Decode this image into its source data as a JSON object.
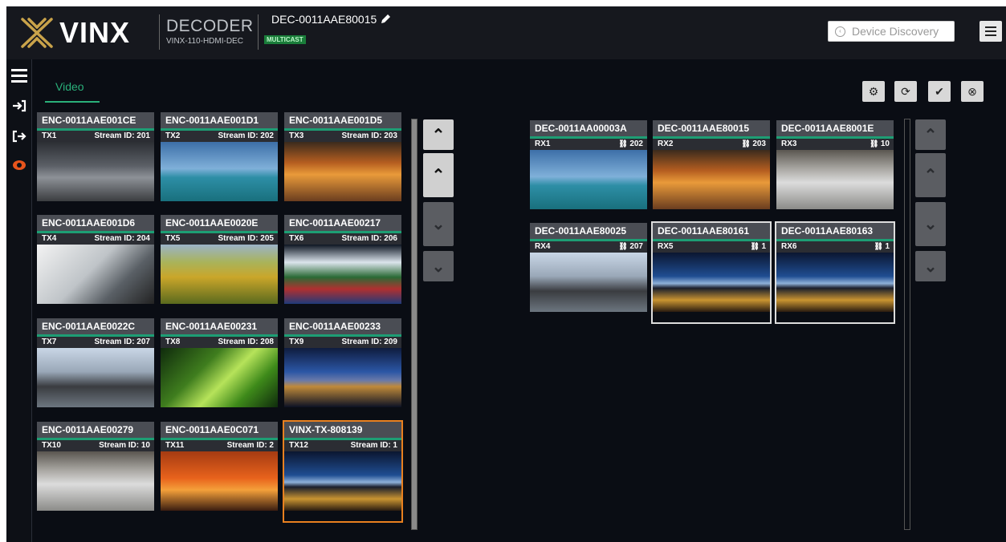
{
  "header": {
    "brand": "VINX",
    "device_type": "DECODER",
    "device_model": "VINX-110-HDMI-DEC",
    "device_name": "DEC-0011AAE80015",
    "mode_badge": "MULTICAST",
    "discovery_label": "Device Discovery"
  },
  "tabs": [
    {
      "label": "Video"
    }
  ],
  "toolbar": [
    "gear-icon",
    "refresh-icon",
    "check-icon",
    "close-icon"
  ],
  "colors": {
    "accent": "#1d9e74",
    "selected_tx": "#e8801f",
    "selected_rx": "#dddddd",
    "danger_icon": "#e7541c"
  },
  "transmitters": [
    {
      "name": "ENC-0011AAE001CE",
      "id": "TX1",
      "stream": "Stream ID: 201"
    },
    {
      "name": "ENC-0011AAE001D1",
      "id": "TX2",
      "stream": "Stream ID: 202"
    },
    {
      "name": "ENC-0011AAE001D5",
      "id": "TX3",
      "stream": "Stream ID: 203"
    },
    {
      "name": "ENC-0011AAE001D6",
      "id": "TX4",
      "stream": "Stream ID: 204"
    },
    {
      "name": "ENC-0011AAE0020E",
      "id": "TX5",
      "stream": "Stream ID: 205"
    },
    {
      "name": "ENC-0011AAE00217",
      "id": "TX6",
      "stream": "Stream ID: 206"
    },
    {
      "name": "ENC-0011AAE0022C",
      "id": "TX7",
      "stream": "Stream ID: 207"
    },
    {
      "name": "ENC-0011AAE00231",
      "id": "TX8",
      "stream": "Stream ID: 208"
    },
    {
      "name": "ENC-0011AAE00233",
      "id": "TX9",
      "stream": "Stream ID: 209"
    },
    {
      "name": "ENC-0011AAE00279",
      "id": "TX10",
      "stream": "Stream ID: 10"
    },
    {
      "name": "ENC-0011AAE0C071",
      "id": "TX11",
      "stream": "Stream ID: 2"
    },
    {
      "name": "VINX-TX-808139",
      "id": "TX12",
      "stream": "Stream ID: 1"
    }
  ],
  "receivers": [
    {
      "name": "DEC-0011AA00003A",
      "id": "RX1",
      "link": "202"
    },
    {
      "name": "DEC-0011AAE80015",
      "id": "RX2",
      "link": "203"
    },
    {
      "name": "DEC-0011AAE8001E",
      "id": "RX3",
      "link": "10"
    },
    {
      "name": "DEC-0011AAE80025",
      "id": "RX4",
      "link": "207"
    },
    {
      "name": "DEC-0011AAE80161",
      "id": "RX5",
      "link": "1"
    },
    {
      "name": "DEC-0011AAE80163",
      "id": "RX6",
      "link": "1"
    }
  ]
}
